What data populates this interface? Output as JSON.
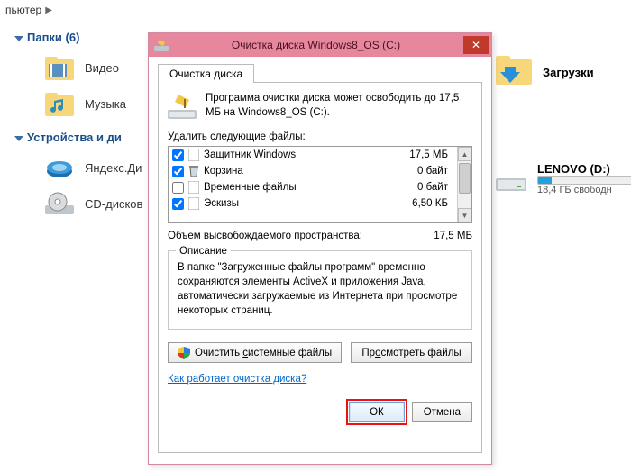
{
  "breadcrumb": {
    "label": "пьютер"
  },
  "explorer": {
    "section1": {
      "title": "Папки (6)"
    },
    "section2": {
      "title": "Устройства и ди"
    },
    "items_left": [
      {
        "label": "Видео"
      },
      {
        "label": "Музыка"
      },
      {
        "label": "Яндекс.Ди"
      },
      {
        "label": "CD-дисков"
      }
    ],
    "downloads": {
      "label": "Загрузки"
    },
    "lenovo": {
      "label": "LENOVO (D:)",
      "free": "18,4 ГБ свободн",
      "fill_percent": 14
    }
  },
  "dialog": {
    "title": "Очистка диска Windows8_OS (C:)",
    "tab_label": "Очистка диска",
    "intro": "Программа очистки диска может освободить до 17,5 МБ на Windows8_OS (C:).",
    "list_label": "Удалить следующие файлы:",
    "files": [
      {
        "checked": true,
        "name": "Защитник Windows",
        "size": "17,5 МБ"
      },
      {
        "checked": true,
        "name": "Корзина",
        "size": "0 байт"
      },
      {
        "checked": false,
        "name": "Временные файлы",
        "size": "0 байт"
      },
      {
        "checked": true,
        "name": "Эскизы",
        "size": "6,50 КБ"
      }
    ],
    "summary_label": "Объем высвобождаемого пространства:",
    "summary_value": "17,5 МБ",
    "group_title": "Описание",
    "group_text": "В папке \"Загруженные файлы программ\" временно сохраняются элементы ActiveX и приложения Java, автоматически загружаемые из Интернета при просмотре некоторых страниц.",
    "btn_clean_sys_prefix": "Очистить ",
    "btn_clean_sys_u": "с",
    "btn_clean_sys_suffix": "истемные файлы",
    "btn_view_prefix": "Пр",
    "btn_view_u": "о",
    "btn_view_suffix": "смотреть файлы",
    "link": "Как работает очистка диска?",
    "ok": "ОК",
    "cancel": "Отмена"
  }
}
